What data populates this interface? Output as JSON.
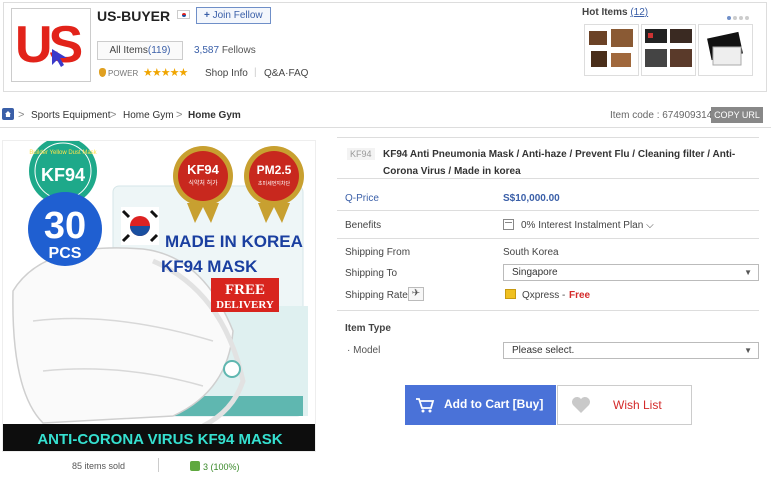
{
  "seller": {
    "name": "US-BUYER",
    "logo_text": "US",
    "join_label": "Join Fellow",
    "all_items_label": "All Items",
    "all_items_count": "(119)",
    "fellows_count": "3,587",
    "fellows_label": "Fellows",
    "power_label": "POWER",
    "stars": "★★★★★",
    "shop_info": "Shop Info",
    "qa": "Q&A·FAQ"
  },
  "hot_items": {
    "label": "Hot Items",
    "count": "(12)"
  },
  "breadcrumb": {
    "items": [
      "Sports Equipment",
      "Home Gym",
      "Home Gym"
    ],
    "separator": ">"
  },
  "item_code": {
    "label": "Item code : 674909314",
    "copy_label": "COPY URL"
  },
  "product": {
    "image": {
      "seal": "Builder Yellow Dust Mask",
      "kf94_badge": "KF94",
      "count": "30",
      "pcs": "PCS",
      "kf94_medal": "KF94",
      "kf94_medal_sub": "식약처 허가",
      "pm_medal": "PM2.5",
      "pm_medal_sub": "초미세먼지차단",
      "made_in": "MADE IN KOREA",
      "mask_label": "KF94 MASK",
      "free": "FREE",
      "delivery": "DELIVERY",
      "banner": "ANTI-CORONA VIRUS KF94 MASK"
    },
    "sold": "85 items sold",
    "likes": "3 (100%)",
    "brand_tag": "KF94",
    "title": "KF94 Anti Pneumonia Mask / Anti-haze / Prevent Flu / Cleaning filter / Anti-Corona Virus / Made in korea"
  },
  "info": {
    "qprice_label": "Q-Price",
    "price": "S$10,000.00",
    "benefits_label": "Benefits",
    "benefit_text": "0% Interest Instalment Plan ⌵",
    "shipping_from_label": "Shipping From",
    "shipping_from": "South Korea",
    "shipping_to_label": "Shipping To",
    "shipping_to": "Singapore",
    "shipping_rate_label": "Shipping Rate",
    "shipping_carrier": "Qxpress -",
    "shipping_free": "Free",
    "item_type_label": "Item Type",
    "model_label": "· Model",
    "model_placeholder": "Please select."
  },
  "actions": {
    "add_to_cart": "Add to Cart [Buy]",
    "wish_list": "Wish List"
  },
  "colors": {
    "accent_blue": "#4a72d8",
    "price_blue": "#3a5fa8",
    "free_red": "#d42a2a",
    "logo_red": "#e2231a"
  }
}
